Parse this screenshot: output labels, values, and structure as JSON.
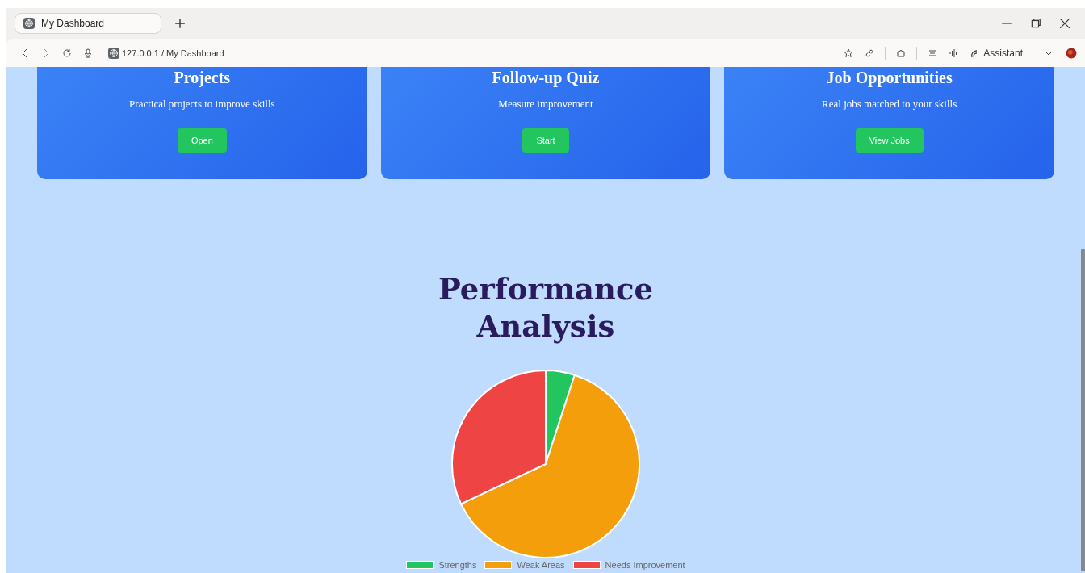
{
  "browser": {
    "tab": {
      "title": "My Dashboard",
      "selected": true
    },
    "address": "127.0.0.1 / My Dashboard",
    "assistant": "Assistant"
  },
  "cards": [
    {
      "title": "Projects",
      "text": "Practical projects to improve skills",
      "button": "Open"
    },
    {
      "title": "Follow-up Quiz",
      "text": "Measure improvement",
      "button": "Start"
    },
    {
      "title": "Job Opportunities",
      "text": "Real jobs matched to your skills",
      "button": "View Jobs"
    }
  ],
  "analysis": {
    "title": "Performance Analysis",
    "legend": [
      {
        "label": "Strengths",
        "color": "#22c55e"
      },
      {
        "label": "Weak Areas",
        "color": "#f59e0b"
      },
      {
        "label": "Needs Improvement",
        "color": "#ef4444"
      }
    ]
  }
}
